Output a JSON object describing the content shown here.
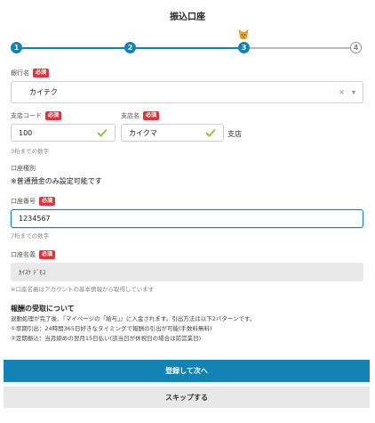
{
  "page": {
    "title": "振込口座"
  },
  "stepper": {
    "steps": [
      "1",
      "2",
      "3",
      "4"
    ]
  },
  "required_badge": "必須",
  "bank": {
    "label": "銀行名",
    "value": "カイテク",
    "clear": "×",
    "chevron": "▾"
  },
  "branch_code": {
    "label": "支店コード",
    "value": "100",
    "hint": "3桁までの数字"
  },
  "branch_name": {
    "label": "支店名",
    "value": "カイクマ",
    "suffix": "支店"
  },
  "account_type": {
    "label": "口座種別",
    "note": "※普通預金のみ設定可能です"
  },
  "account_number": {
    "label": "口座番号",
    "value": "1234567",
    "hint": "7桁までの数字"
  },
  "account_holder": {
    "label": "口座名義",
    "value": "ｶｲｽｹ ﾃﾞﾓｺ",
    "note": "※口座名義はアカウントの基本情報から取得しています"
  },
  "reward": {
    "title": "報酬の受取について",
    "lines": [
      "退勤処理が完了後、『マイページの「給与」』に入金されます。引出方法は以下2パターンです。",
      "①早期引出：24時間365日好きなタイミングで報酬の引出が可能(手数料無料)",
      "②定期振込：当月締めの翌月15日払い(該当日が休祝日の場合は前営業日)"
    ]
  },
  "buttons": {
    "primary": "登録して次へ",
    "secondary": "スキップする"
  },
  "colors": {
    "accent": "#1383b4",
    "required": "#e0343a",
    "check": "#8cc63f"
  }
}
